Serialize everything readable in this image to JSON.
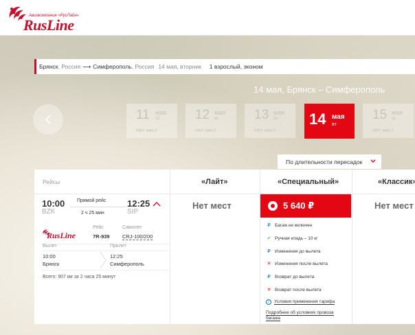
{
  "brand": {
    "name": "RusLine",
    "tagline": "Авиакомпания «РусЛайн»",
    "color": "#c8102e"
  },
  "search": {
    "from_city": "Брянск",
    "from_country": "Россия",
    "to_city": "Симферополь",
    "to_country": "Россия",
    "date": "14 мая, вторник",
    "passengers": "1 взрослый, эконом"
  },
  "route_title": "14 мая, Брянск – Симферополь",
  "dates": [
    {
      "day": "11",
      "month": "мая",
      "weekday": "сб",
      "price": "Нет мест"
    },
    {
      "day": "12",
      "month": "мая",
      "weekday": "вс",
      "price": "Нет мест"
    },
    {
      "day": "13",
      "month": "мая",
      "weekday": "пн",
      "price": "Нет мест"
    },
    {
      "day": "14",
      "month": "мая",
      "weekday": "вт",
      "price": ""
    },
    {
      "day": "15",
      "month": "мая",
      "weekday": "ср",
      "price": "Нет мест"
    }
  ],
  "sort_label": "По длительности пересадок",
  "table": {
    "flights_header": "Рейсы",
    "tariffs": [
      "«Лайт»",
      "«Специальный»",
      "«Классик»"
    ]
  },
  "flight": {
    "dep_time": "10:00",
    "dep_code": "BZK",
    "arr_time": "12:25",
    "arr_code": "SIP",
    "type": "Прямой рейс",
    "duration": "2 ч 25 мин",
    "flight_label": "Рейс",
    "flight_no": "7R-939",
    "aircraft_label": "Самолет",
    "aircraft": "CRJ-100/200",
    "departure_label": "Вылет",
    "arrival_label": "Прилет",
    "dep_detail_time": "10:00",
    "dep_detail_city": "Брянск",
    "arr_detail_time": "12:25",
    "arr_detail_city": "Симферополь",
    "total": "Всего:  907 км за 2 часа 25 минут"
  },
  "fares": {
    "lite": "Нет мест",
    "special_price": "5 640 ₽",
    "classic": "Нет мест"
  },
  "features": [
    {
      "icon": "rub",
      "text": "Багаж не включен"
    },
    {
      "icon": "ok",
      "text": "Ручная кладь – 10 кг"
    },
    {
      "icon": "rub",
      "text": "Изменения до вылета"
    },
    {
      "icon": "x",
      "text": "Изменения после вылета"
    },
    {
      "icon": "rub",
      "text": "Возврат до вылета"
    },
    {
      "icon": "x",
      "text": "Возврат после вылета"
    }
  ],
  "links": {
    "fare_rules": "Условия применения тарифа",
    "baggage_1": "Подробнее об условиях провоза",
    "baggage_2": "багажа"
  },
  "colors": {
    "accent": "#e30613",
    "info": "#0072bc",
    "ok": "#6cb33f"
  }
}
